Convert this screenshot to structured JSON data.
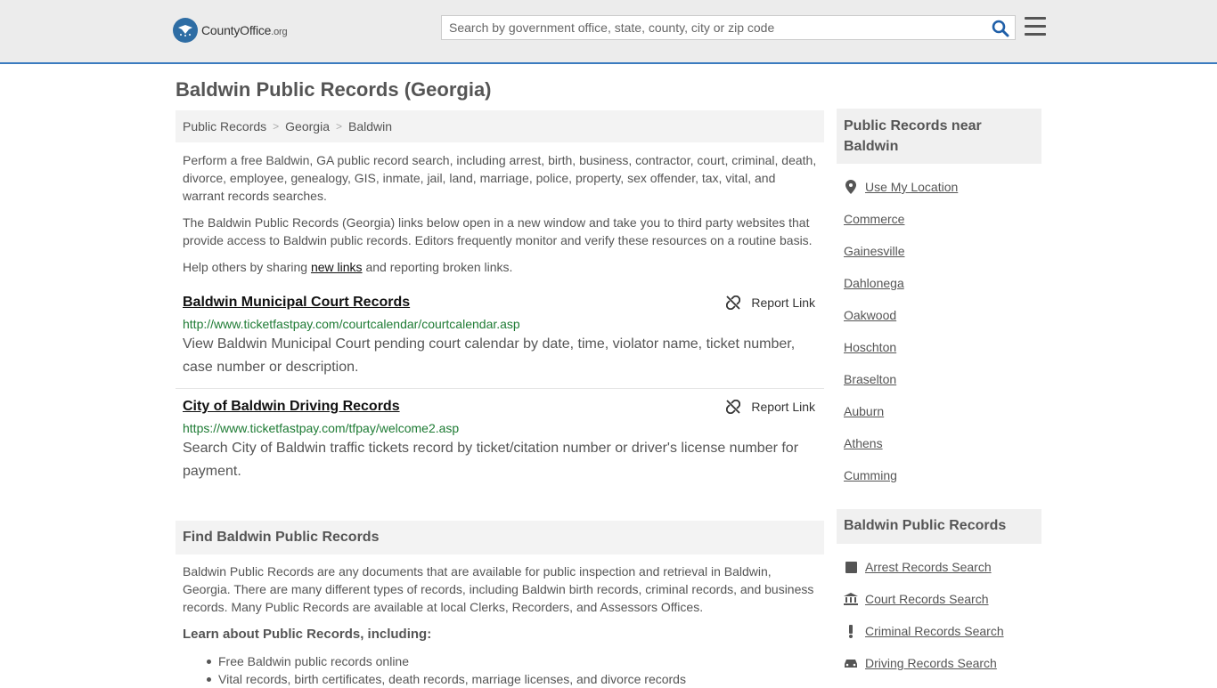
{
  "header": {
    "logo_text": "CountyOffice",
    "logo_suffix": ".org",
    "search_placeholder": "Search by government office, state, county, city or zip code"
  },
  "page": {
    "title": "Baldwin Public Records (Georgia)"
  },
  "breadcrumb": [
    "Public Records",
    "Georgia",
    "Baldwin"
  ],
  "intro": {
    "p1": "Perform a free Baldwin, GA public record search, including arrest, birth, business, contractor, court, criminal, death, divorce, employee, genealogy, GIS, inmate, jail, land, marriage, police, property, sex offender, tax, vital, and warrant records searches.",
    "p2": "The Baldwin Public Records (Georgia) links below open in a new window and take you to third party websites that provide access to Baldwin public records. Editors frequently monitor and verify these resources on a routine basis.",
    "p3_pre": "Help others by sharing ",
    "p3_link": "new links",
    "p3_post": " and reporting broken links."
  },
  "records": [
    {
      "title": "Baldwin Municipal Court Records",
      "report": "Report Link",
      "url": "http://www.ticketfastpay.com/courtcalendar/courtcalendar.asp",
      "desc": "View Baldwin Municipal Court pending court calendar by date, time, violator name, ticket number, case number or description."
    },
    {
      "title": "City of Baldwin Driving Records",
      "report": "Report Link",
      "url": "https://www.ticketfastpay.com/tfpay/welcome2.asp",
      "desc": "Search City of Baldwin traffic tickets record by ticket/citation number or driver's license number for payment."
    }
  ],
  "find": {
    "heading": "Find Baldwin Public Records",
    "text": "Baldwin Public Records are any documents that are available for public inspection and retrieval in Baldwin, Georgia. There are many different types of records, including Baldwin birth records, criminal records, and business records. Many Public Records are available at local Clerks, Recorders, and Assessors Offices.",
    "learn": "Learn about Public Records, including:",
    "bullets": [
      "Free Baldwin public records online",
      "Vital records, birth certificates, death records, marriage licenses, and divorce records"
    ]
  },
  "sidebar": {
    "near_heading": "Public Records near Baldwin",
    "use_location": "Use My Location",
    "near": [
      "Commerce",
      "Gainesville",
      "Dahlonega",
      "Oakwood",
      "Hoschton",
      "Braselton",
      "Auburn",
      "Athens",
      "Cumming"
    ],
    "records_heading": "Baldwin Public Records",
    "records_links": [
      "Arrest Records Search",
      "Court Records Search",
      "Criminal Records Search",
      "Driving Records Search"
    ]
  }
}
